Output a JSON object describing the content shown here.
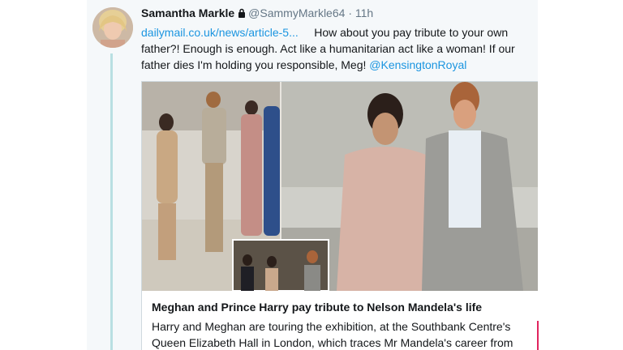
{
  "tweet": {
    "author_name": "Samantha Markle",
    "author_handle": "@SammyMarkle64",
    "separator": "·",
    "time": "11h",
    "link_text": "dailymail.co.uk/news/article-5...",
    "text": "How about you pay tribute to your own father?! Enough is enough. Act like a humanitarian act like a woman! If our father dies I'm holding you responsible, Meg!",
    "mention": "@KensingtonRoyal"
  },
  "card": {
    "title": "Meghan and Prince Harry pay tribute to Nelson Mandela's life",
    "description": "Harry and Meghan are touring the exhibition, at the Southbank Centre's Queen Elizabeth Hall in London, which traces Mr Mandela's career from"
  },
  "icons": {
    "lock": "lock-icon"
  },
  "colors": {
    "link": "#1b95e0",
    "thread_line": "#b8dfe2",
    "text": "#14171a",
    "muted": "#657786"
  }
}
